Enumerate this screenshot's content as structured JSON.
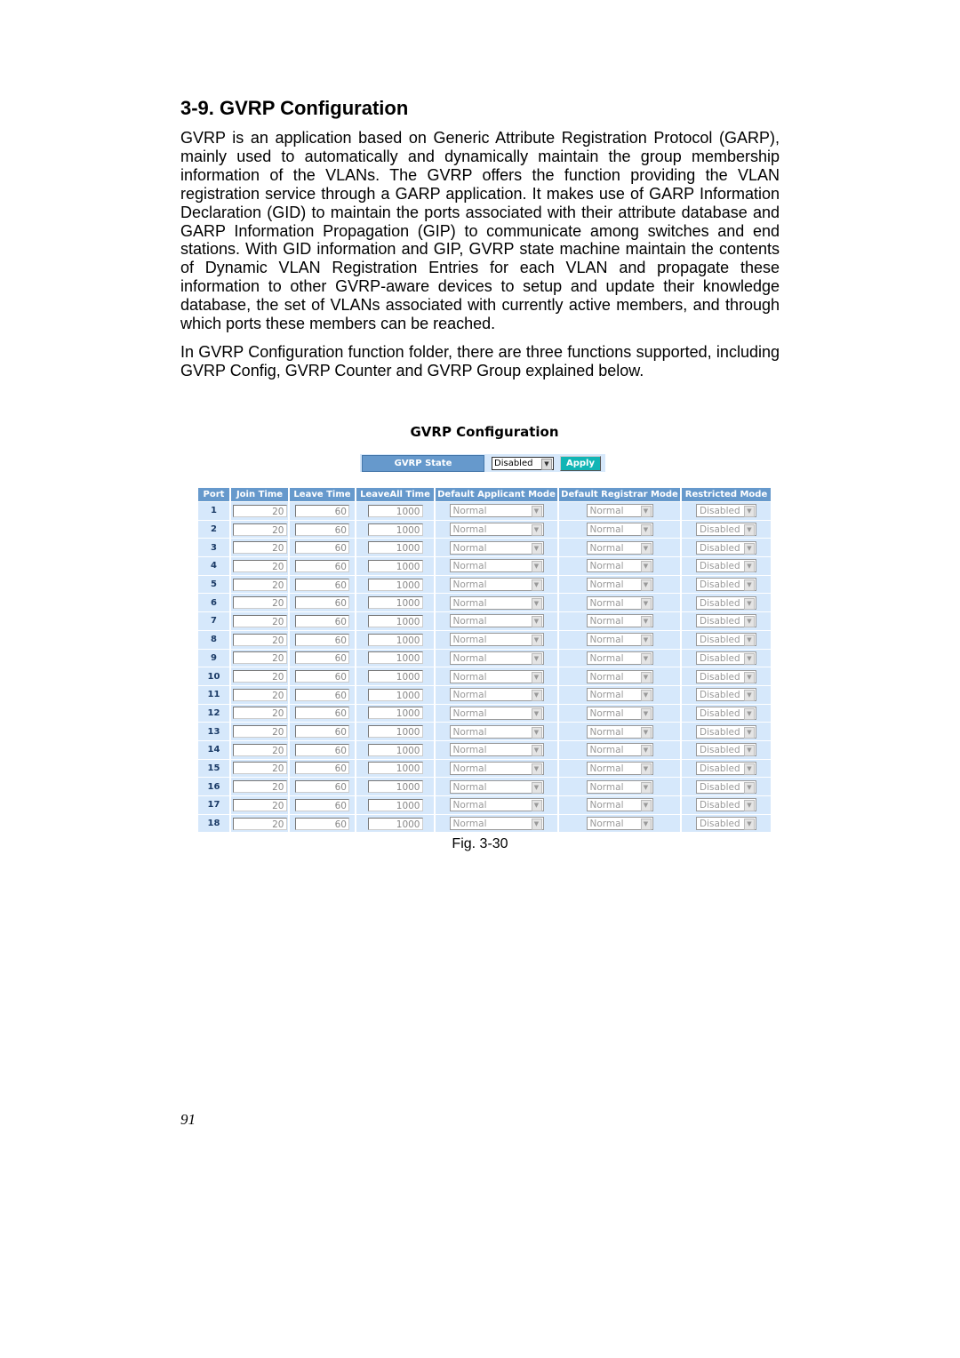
{
  "section_title": "3-9. GVRP Configuration",
  "paragraphs": [
    "GVRP is an application based on Generic Attribute Registration Protocol (GARP), mainly used to automatically and dynamically maintain the group membership information of the VLANs. The GVRP offers the function providing the VLAN registration service through a GARP application. It makes use of GARP Information Declaration (GID) to maintain the ports associated with their attribute database and GARP Information Propagation (GIP) to communicate among switches and end stations. With GID information and GIP, GVRP state machine maintain the contents of Dynamic VLAN Registration Entries for each VLAN and propagate these information to other GVRP-aware devices to setup and update their knowledge database, the set of VLANs associated with currently active members, and through which ports these members can be reached.",
    "In GVRP Configuration function folder, there are three functions supported, including GVRP Config, GVRP Counter and GVRP Group explained below."
  ],
  "figure": {
    "title": "GVRP Configuration",
    "state_label": "GVRP State",
    "state_value": "Disabled",
    "apply_label": "Apply",
    "columns": [
      "Port",
      "Join Time",
      "Leave Time",
      "LeaveAll Time",
      "Default Applicant Mode",
      "Default Registrar Mode",
      "Restricted Mode"
    ],
    "rows": [
      {
        "port": "1",
        "join": "20",
        "leave": "60",
        "leaveall": "1000",
        "applicant": "Normal",
        "registrar": "Normal",
        "restricted": "Disabled"
      },
      {
        "port": "2",
        "join": "20",
        "leave": "60",
        "leaveall": "1000",
        "applicant": "Normal",
        "registrar": "Normal",
        "restricted": "Disabled"
      },
      {
        "port": "3",
        "join": "20",
        "leave": "60",
        "leaveall": "1000",
        "applicant": "Normal",
        "registrar": "Normal",
        "restricted": "Disabled"
      },
      {
        "port": "4",
        "join": "20",
        "leave": "60",
        "leaveall": "1000",
        "applicant": "Normal",
        "registrar": "Normal",
        "restricted": "Disabled"
      },
      {
        "port": "5",
        "join": "20",
        "leave": "60",
        "leaveall": "1000",
        "applicant": "Normal",
        "registrar": "Normal",
        "restricted": "Disabled"
      },
      {
        "port": "6",
        "join": "20",
        "leave": "60",
        "leaveall": "1000",
        "applicant": "Normal",
        "registrar": "Normal",
        "restricted": "Disabled"
      },
      {
        "port": "7",
        "join": "20",
        "leave": "60",
        "leaveall": "1000",
        "applicant": "Normal",
        "registrar": "Normal",
        "restricted": "Disabled"
      },
      {
        "port": "8",
        "join": "20",
        "leave": "60",
        "leaveall": "1000",
        "applicant": "Normal",
        "registrar": "Normal",
        "restricted": "Disabled"
      },
      {
        "port": "9",
        "join": "20",
        "leave": "60",
        "leaveall": "1000",
        "applicant": "Normal",
        "registrar": "Normal",
        "restricted": "Disabled"
      },
      {
        "port": "10",
        "join": "20",
        "leave": "60",
        "leaveall": "1000",
        "applicant": "Normal",
        "registrar": "Normal",
        "restricted": "Disabled"
      },
      {
        "port": "11",
        "join": "20",
        "leave": "60",
        "leaveall": "1000",
        "applicant": "Normal",
        "registrar": "Normal",
        "restricted": "Disabled"
      },
      {
        "port": "12",
        "join": "20",
        "leave": "60",
        "leaveall": "1000",
        "applicant": "Normal",
        "registrar": "Normal",
        "restricted": "Disabled"
      },
      {
        "port": "13",
        "join": "20",
        "leave": "60",
        "leaveall": "1000",
        "applicant": "Normal",
        "registrar": "Normal",
        "restricted": "Disabled"
      },
      {
        "port": "14",
        "join": "20",
        "leave": "60",
        "leaveall": "1000",
        "applicant": "Normal",
        "registrar": "Normal",
        "restricted": "Disabled"
      },
      {
        "port": "15",
        "join": "20",
        "leave": "60",
        "leaveall": "1000",
        "applicant": "Normal",
        "registrar": "Normal",
        "restricted": "Disabled"
      },
      {
        "port": "16",
        "join": "20",
        "leave": "60",
        "leaveall": "1000",
        "applicant": "Normal",
        "registrar": "Normal",
        "restricted": "Disabled"
      },
      {
        "port": "17",
        "join": "20",
        "leave": "60",
        "leaveall": "1000",
        "applicant": "Normal",
        "registrar": "Normal",
        "restricted": "Disabled"
      },
      {
        "port": "18",
        "join": "20",
        "leave": "60",
        "leaveall": "1000",
        "applicant": "Normal",
        "registrar": "Normal",
        "restricted": "Disabled"
      }
    ],
    "caption": "Fig. 3-30"
  },
  "page_number": "91",
  "colors": {
    "header_bg": "#6699cc",
    "row_bg": "#d6e8fb",
    "apply_bg": "#11b5b5"
  }
}
